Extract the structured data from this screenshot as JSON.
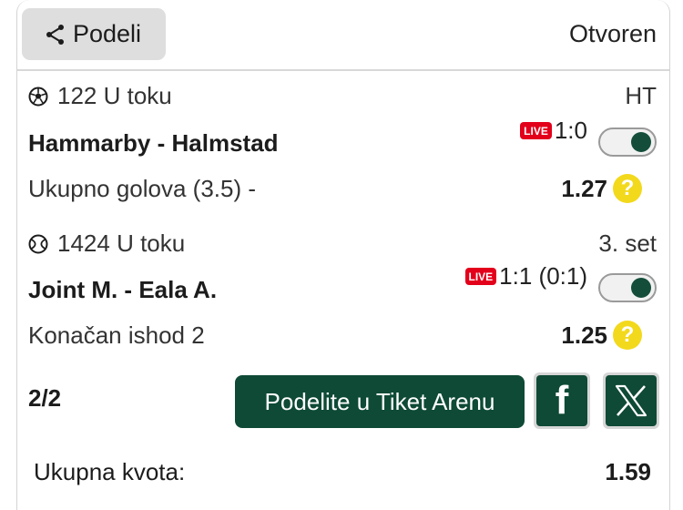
{
  "header": {
    "share_label": "Podeli",
    "status": "Otvoren"
  },
  "events": [
    {
      "sport_icon": "soccer-ball-icon",
      "event_info": "122 U toku",
      "period": "HT",
      "teams": "Hammarby - Halmstad",
      "live_badge": "LIVE",
      "score": "1:0",
      "toggle_on": true,
      "market": "Ukupno golova (3.5) -",
      "odd": "1.27",
      "help_glyph": "?"
    },
    {
      "sport_icon": "tennis-ball-icon",
      "event_info": "1424 U toku",
      "period": "3. set",
      "teams": "Joint M. - Eala A.",
      "live_badge": "LIVE",
      "score": "1:1 (0:1)",
      "toggle_on": true,
      "market": "Konačan ishod 2",
      "odd": "1.25",
      "help_glyph": "?"
    }
  ],
  "footer": {
    "count": "2/2",
    "arena_button": "Podelite u Tiket Arenu",
    "facebook_glyph": "f",
    "total_label": "Ukupna kvota:",
    "total_value": "1.59"
  },
  "colors": {
    "brand_green": "#0e4a35",
    "live_red": "#e3001b",
    "help_yellow": "#f2d91c"
  }
}
